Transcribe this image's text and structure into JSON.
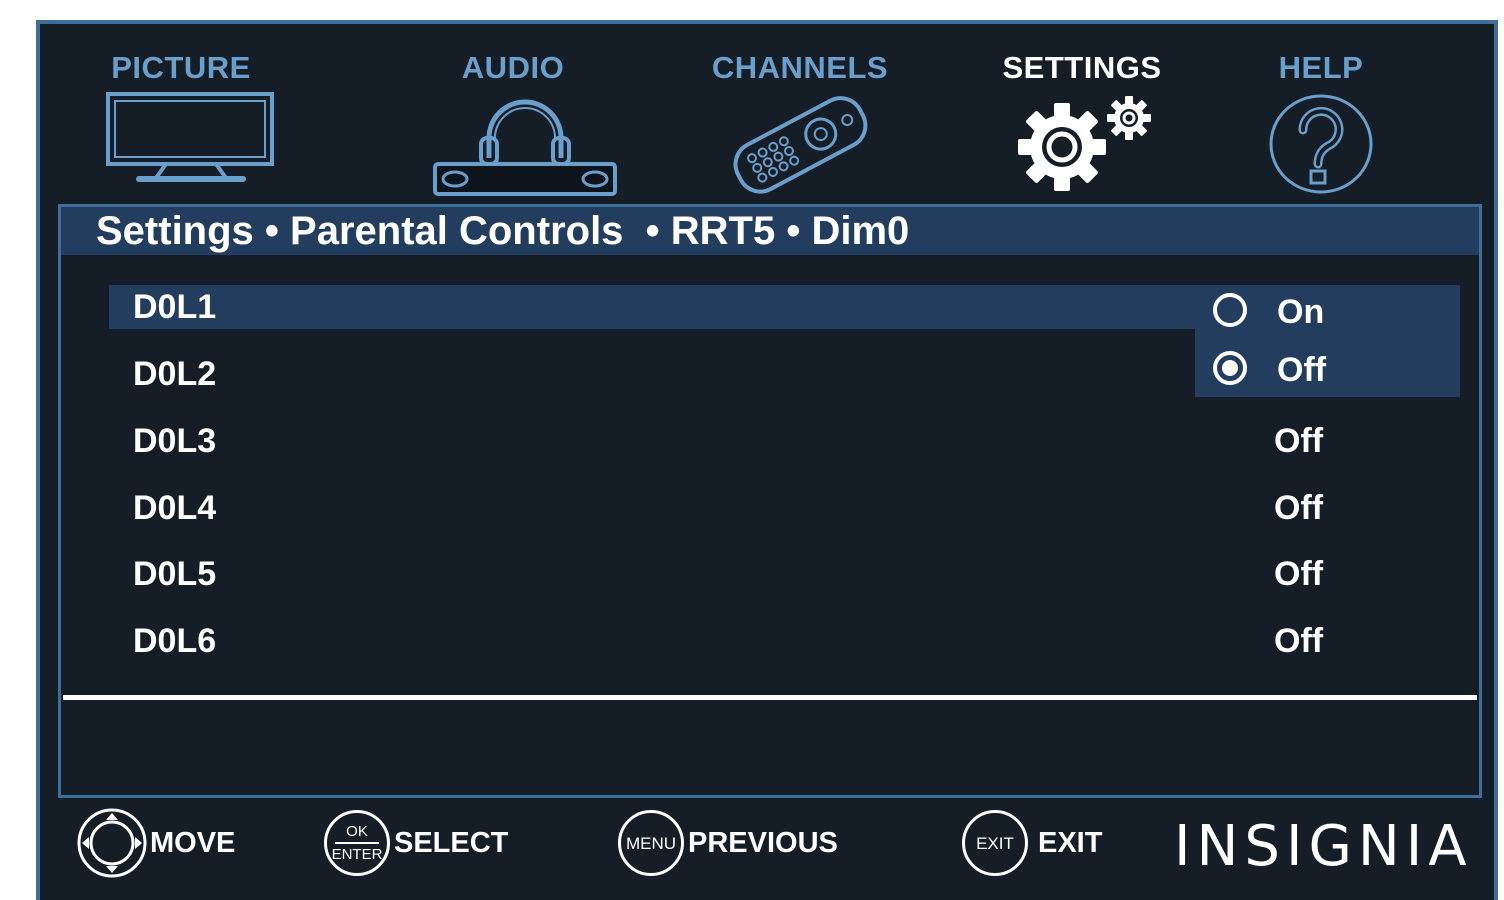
{
  "tabs": [
    {
      "label": "PICTURE",
      "icon": "tv-icon",
      "active": false
    },
    {
      "label": "AUDIO",
      "icon": "headphones-icon",
      "active": false
    },
    {
      "label": "CHANNELS",
      "icon": "remote-icon",
      "active": false
    },
    {
      "label": "SETTINGS",
      "icon": "gear-icon",
      "active": true
    },
    {
      "label": "HELP",
      "icon": "help-icon",
      "active": false
    }
  ],
  "breadcrumb": "Settings • Parental Controls  • RRT5 • Dim0",
  "rows": [
    {
      "name": "D0L1",
      "value": ""
    },
    {
      "name": "D0L2",
      "value": ""
    },
    {
      "name": "D0L3",
      "value": "Off"
    },
    {
      "name": "D0L4",
      "value": "Off"
    },
    {
      "name": "D0L5",
      "value": "Off"
    },
    {
      "name": "D0L6",
      "value": "Off"
    }
  ],
  "popup": {
    "options": [
      {
        "label": "On",
        "selected": false
      },
      {
        "label": "Off",
        "selected": true
      }
    ]
  },
  "footer": {
    "move": {
      "label": "MOVE",
      "icon": "dpad-icon"
    },
    "select": {
      "label": "SELECT",
      "key_top": "OK",
      "key_bottom": "ENTER"
    },
    "previous": {
      "label": "PREVIOUS",
      "key": "MENU"
    },
    "exit": {
      "label": "EXIT",
      "key": "EXIT"
    },
    "brand": "INSIGNIA"
  },
  "colors": {
    "background": "#151d26",
    "accent": "#3f6f99",
    "highlight": "#233d5f",
    "tab_inactive": "#6a9ecb"
  }
}
